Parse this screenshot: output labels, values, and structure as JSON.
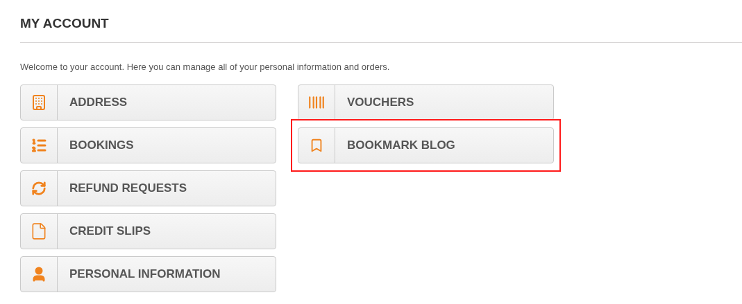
{
  "title": "MY ACCOUNT",
  "intro": "Welcome to your account. Here you can manage all of your personal information and orders.",
  "columns": [
    {
      "items": [
        {
          "label": "ADDRESS",
          "kind": "building",
          "highlighted": false
        },
        {
          "label": "BOOKINGS",
          "kind": "list",
          "highlighted": false
        },
        {
          "label": "REFUND REQUESTS",
          "kind": "refresh",
          "highlighted": false
        },
        {
          "label": "CREDIT SLIPS",
          "kind": "file",
          "highlighted": false
        },
        {
          "label": "PERSONAL INFORMATION",
          "kind": "user",
          "highlighted": false
        }
      ]
    },
    {
      "items": [
        {
          "label": "VOUCHERS",
          "kind": "barcode",
          "highlighted": false
        },
        {
          "label": "BOOKMARK BLOG",
          "kind": "bookmark",
          "highlighted": true
        }
      ]
    }
  ]
}
